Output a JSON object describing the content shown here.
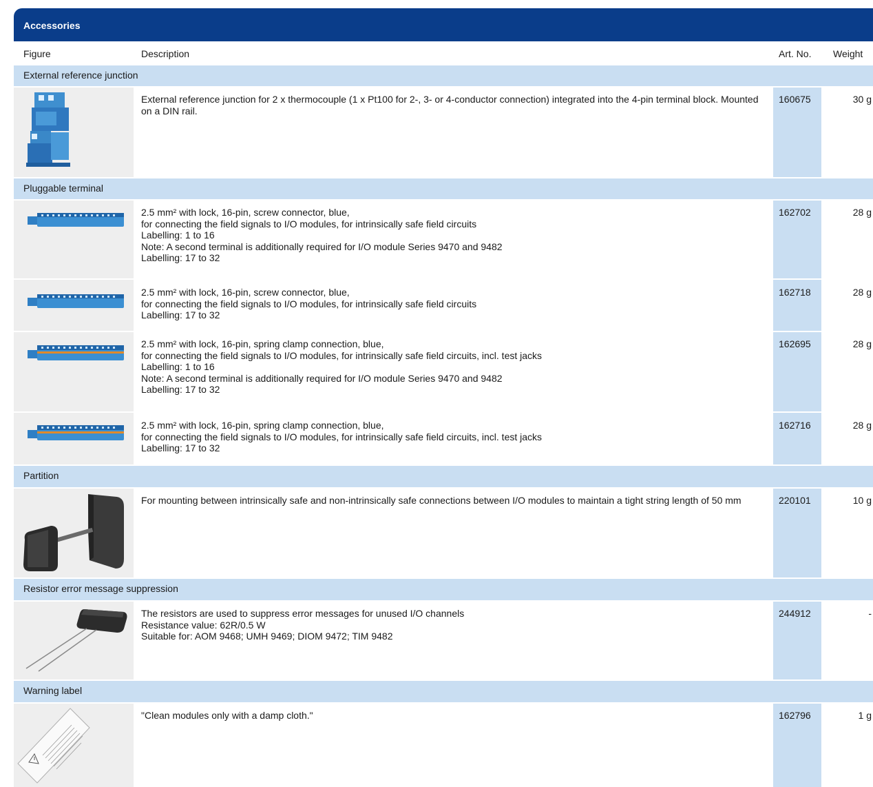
{
  "title": "Accessories",
  "headers": {
    "figure": "Figure",
    "description": "Description",
    "art_no": "Art. No.",
    "weight": "Weight"
  },
  "categories": [
    {
      "label": "External reference junction"
    },
    {
      "label": "Pluggable terminal"
    },
    {
      "label": "Partition"
    },
    {
      "label": "Resistor error message suppression"
    },
    {
      "label": "Warning label"
    }
  ],
  "rows": [
    {
      "desc": [
        "External reference junction for 2 x thermocouple (1 x Pt100 for 2-, 3- or 4-conductor connection) integrated into the 4-pin terminal block. Mounted on a DIN rail."
      ],
      "art": "160675",
      "weight": "30 g"
    },
    {
      "desc": [
        "2.5 mm² with lock, 16-pin, screw connector, blue,",
        "for connecting the field signals to I/O modules, for intrinsically safe field circuits",
        "Labelling: 1 to 16",
        "Note: A second terminal is additionally required for I/O module Series 9470 and 9482",
        "Labelling: 17 to 32"
      ],
      "art": "162702",
      "weight": "28 g"
    },
    {
      "desc": [
        "2.5 mm² with lock, 16-pin, screw connector, blue,",
        "for connecting the field signals to I/O modules, for intrinsically safe field circuits",
        "Labelling: 17 to 32"
      ],
      "art": "162718",
      "weight": "28 g"
    },
    {
      "desc": [
        "2.5 mm² with lock, 16-pin, spring clamp connection, blue,",
        "for connecting the field signals to I/O modules, for intrinsically safe field circuits, incl. test jacks",
        "Labelling: 1 to 16",
        "Note: A second terminal is additionally required for I/O module Series 9470 and 9482",
        "Labelling: 17 to 32"
      ],
      "art": "162695",
      "weight": "28 g"
    },
    {
      "desc": [
        "2.5 mm² with lock, 16-pin, spring clamp connection, blue,",
        "for connecting the field signals to I/O modules, for intrinsically safe field circuits, incl. test jacks",
        "Labelling: 17 to 32"
      ],
      "art": "162716",
      "weight": "28 g"
    },
    {
      "desc": [
        "For mounting between intrinsically safe and non-intrinsically safe connections between I/O modules to maintain a tight string length of 50 mm"
      ],
      "art": "220101",
      "weight": "10 g"
    },
    {
      "desc": [
        "The resistors are used to suppress error messages for unused I/O channels",
        "Resistance value: 62R/0.5 W",
        "Suitable for: AOM 9468; UMH 9469; DIOM 9472; TIM 9482"
      ],
      "art": "244912",
      "weight": "-"
    },
    {
      "desc": [
        "\"Clean modules only with a damp cloth.\""
      ],
      "art": "162796",
      "weight": "1 g"
    }
  ]
}
